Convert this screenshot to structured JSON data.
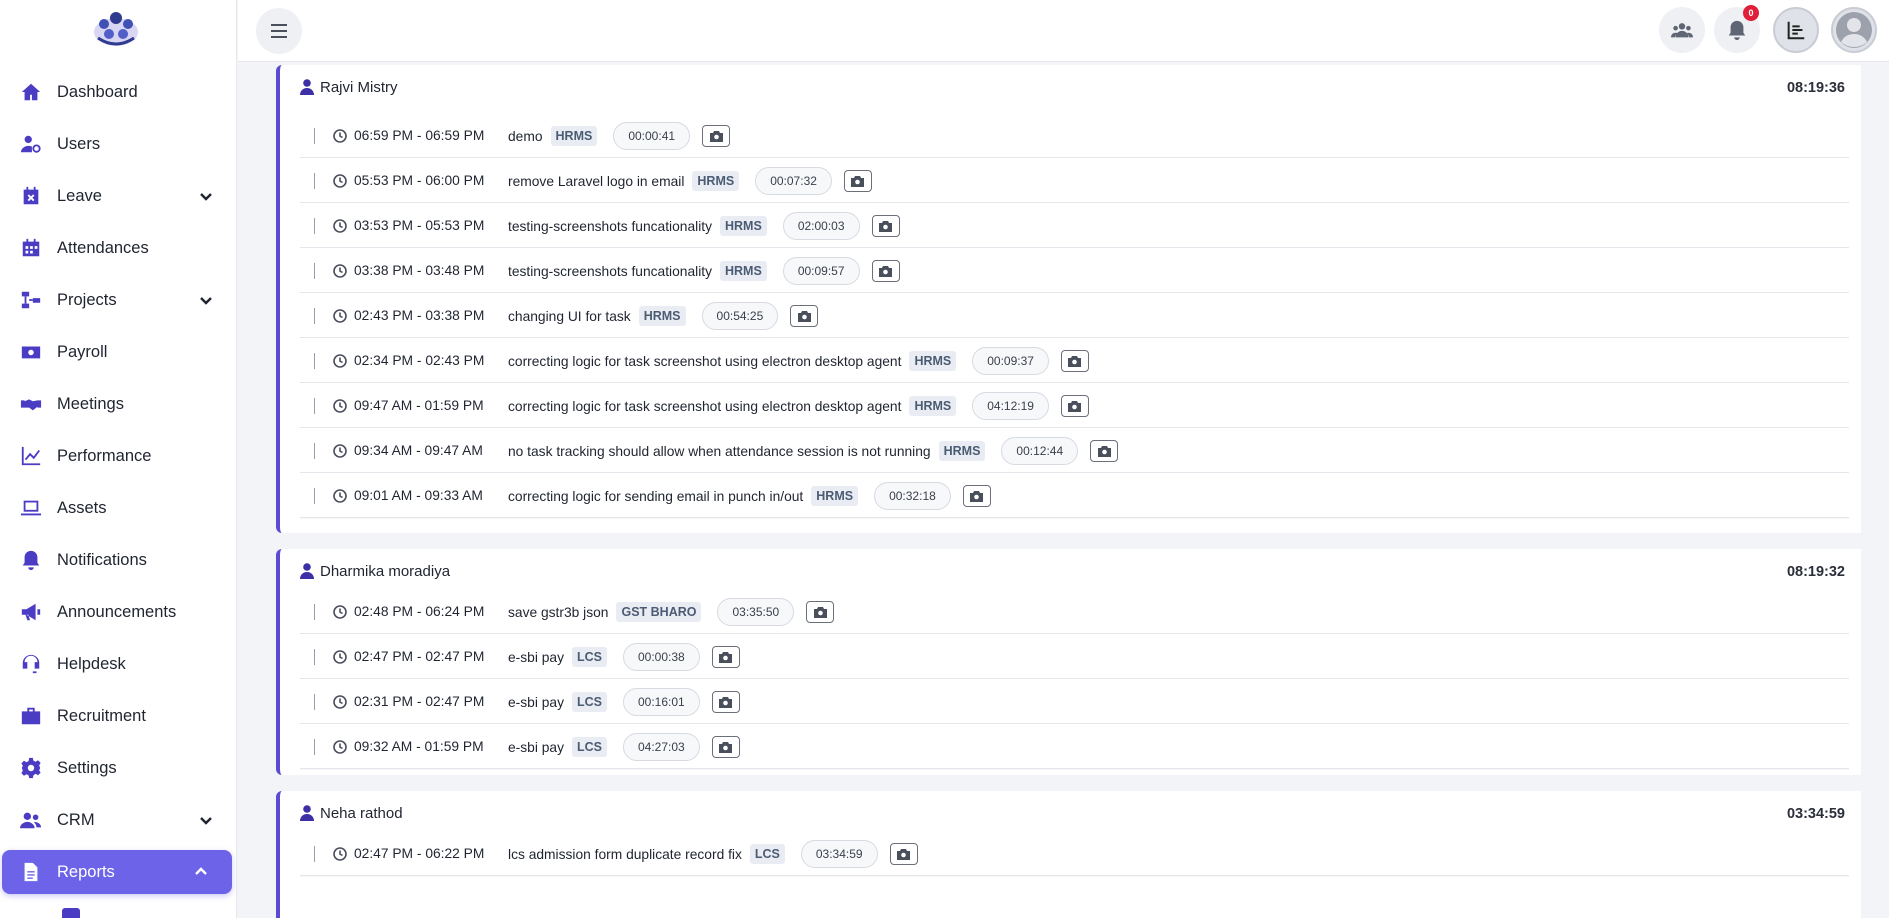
{
  "sidebar": {
    "items": [
      {
        "label": "Dashboard",
        "icon": "home-icon"
      },
      {
        "label": "Users",
        "icon": "user-gear-icon"
      },
      {
        "label": "Leave",
        "icon": "calendar-x-icon",
        "chevron": "down"
      },
      {
        "label": "Attendances",
        "icon": "calendar-icon"
      },
      {
        "label": "Projects",
        "icon": "diagram-icon",
        "chevron": "down"
      },
      {
        "label": "Payroll",
        "icon": "money-icon"
      },
      {
        "label": "Meetings",
        "icon": "handshake-icon"
      },
      {
        "label": "Performance",
        "icon": "line-chart-icon"
      },
      {
        "label": "Assets",
        "icon": "laptop-icon"
      },
      {
        "label": "Notifications",
        "icon": "bell-icon"
      },
      {
        "label": "Announcements",
        "icon": "megaphone-icon"
      },
      {
        "label": "Helpdesk",
        "icon": "headset-icon"
      },
      {
        "label": "Recruitment",
        "icon": "briefcase-icon"
      },
      {
        "label": "Settings",
        "icon": "gear-icon"
      },
      {
        "label": "CRM",
        "icon": "users-icon",
        "chevron": "down"
      },
      {
        "label": "Reports",
        "icon": "file-icon",
        "chevron": "up",
        "active": true
      }
    ]
  },
  "header": {
    "notification_count": "0"
  },
  "groups": [
    {
      "user": "Rajvi Mistry",
      "total": "08:19:36",
      "entries": [
        {
          "time": "06:59 PM - 06:59 PM",
          "task": "demo",
          "project": "HRMS",
          "duration": "00:00:41"
        },
        {
          "time": "05:53 PM - 06:00 PM",
          "task": "remove Laravel logo in email",
          "project": "HRMS",
          "duration": "00:07:32"
        },
        {
          "time": "03:53 PM - 05:53 PM",
          "task": "testing-screenshots funcationality",
          "project": "HRMS",
          "duration": "02:00:03"
        },
        {
          "time": "03:38 PM - 03:48 PM",
          "task": "testing-screenshots funcationality",
          "project": "HRMS",
          "duration": "00:09:57"
        },
        {
          "time": "02:43 PM - 03:38 PM",
          "task": "changing UI for task",
          "project": "HRMS",
          "duration": "00:54:25"
        },
        {
          "time": "02:34 PM - 02:43 PM",
          "task": "correcting logic for task screenshot using electron desktop agent",
          "project": "HRMS",
          "duration": "00:09:37"
        },
        {
          "time": "09:47 AM - 01:59 PM",
          "task": "correcting logic for task screenshot using electron desktop agent",
          "project": "HRMS",
          "duration": "04:12:19"
        },
        {
          "time": "09:34 AM - 09:47 AM",
          "task": "no task tracking should allow when attendance session is not running",
          "project": "HRMS",
          "duration": "00:12:44"
        },
        {
          "time": "09:01 AM - 09:33 AM",
          "task": "correcting logic for sending email in punch in/out",
          "project": "HRMS",
          "duration": "00:32:18"
        }
      ]
    },
    {
      "user": "Dharmika moradiya",
      "total": "08:19:32",
      "entries": [
        {
          "time": "02:48 PM - 06:24 PM",
          "task": "save gstr3b json",
          "project": "GST BHARO",
          "duration": "03:35:50"
        },
        {
          "time": "02:47 PM - 02:47 PM",
          "task": "e-sbi pay",
          "project": "LCS",
          "duration": "00:00:38"
        },
        {
          "time": "02:31 PM - 02:47 PM",
          "task": "e-sbi pay",
          "project": "LCS",
          "duration": "00:16:01"
        },
        {
          "time": "09:32 AM - 01:59 PM",
          "task": "e-sbi pay",
          "project": "LCS",
          "duration": "04:27:03"
        }
      ]
    },
    {
      "user": "Neha rathod",
      "total": "03:34:59",
      "entries": [
        {
          "time": "02:47 PM - 06:22 PM",
          "task": "lcs admission form duplicate record fix",
          "project": "LCS",
          "duration": "03:34:59"
        }
      ]
    }
  ],
  "colors": {
    "accent": "#6c63e9",
    "icon": "#4b3cc4",
    "group_border": "#5b4bd2",
    "badge": "#e0203a"
  }
}
